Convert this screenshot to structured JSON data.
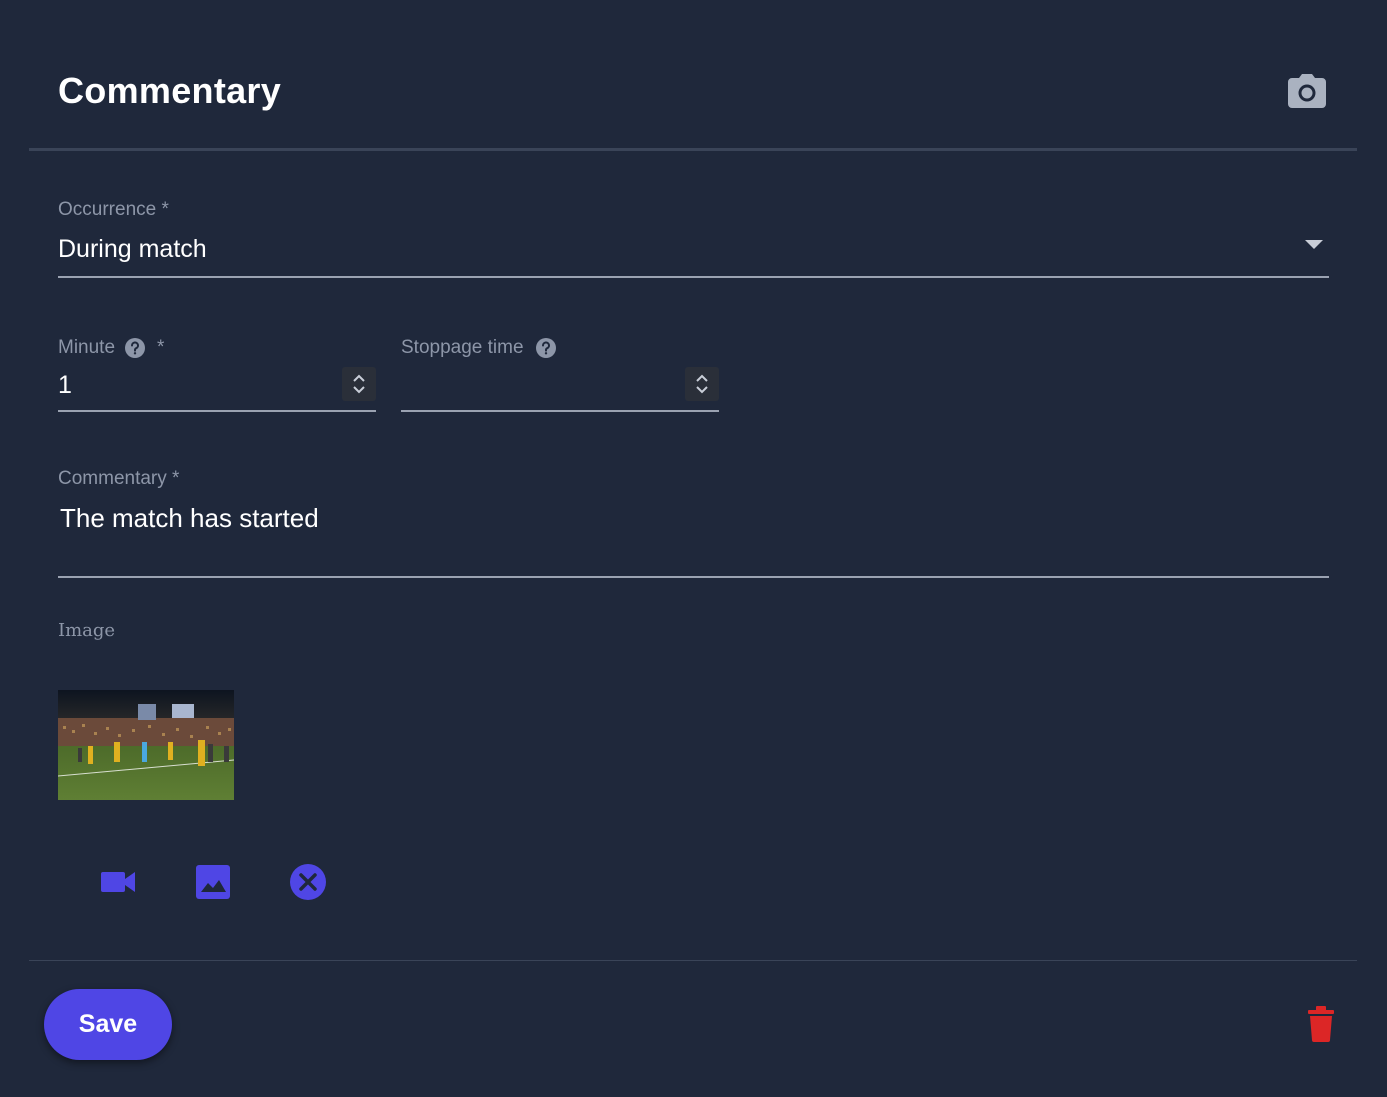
{
  "header": {
    "title": "Commentary",
    "icon": "camera-icon"
  },
  "form": {
    "occurrence": {
      "label": "Occurrence *",
      "value": "During match"
    },
    "minute": {
      "label": "Minute",
      "required_mark": "*",
      "value": "1"
    },
    "stoppage": {
      "label": "Stoppage time",
      "value": ""
    },
    "commentary": {
      "label": "Commentary *",
      "value": "The match has started"
    },
    "image": {
      "label": "Image"
    }
  },
  "media_actions": [
    "video-camera-icon",
    "image-icon",
    "cancel-circle-icon"
  ],
  "footer": {
    "save_label": "Save",
    "delete_icon": "trash-icon"
  },
  "colors": {
    "background": "#1f283b",
    "accent": "#4f46e5",
    "danger": "#dc2626",
    "muted_text": "#8d96a8"
  }
}
